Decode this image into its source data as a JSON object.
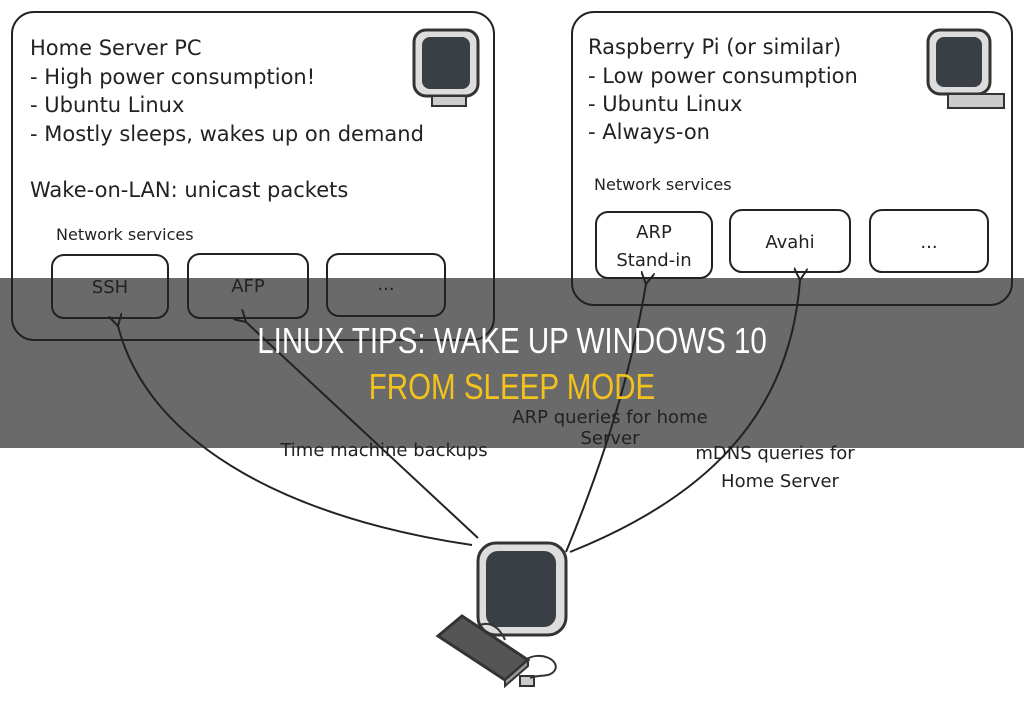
{
  "diagram": {
    "home_server": {
      "title": "Home Server PC",
      "lines": [
        "- High power consumption!",
        "- Ubuntu Linux",
        "- Mostly sleeps, wakes up on demand"
      ],
      "wol": "Wake-on-LAN: unicast packets",
      "services_label": "Network services",
      "services": [
        "SSH",
        "AFP",
        "..."
      ]
    },
    "raspberry": {
      "title": "Raspberry Pi (or similar)",
      "lines": [
        "- Low power consumption",
        "- Ubuntu Linux",
        "- Always-on"
      ],
      "services_label": "Network services",
      "services": [
        "ARP",
        "Stand-in",
        "Avahi",
        "..."
      ]
    },
    "edges": {
      "arp": [
        "ARP queries for home",
        "Server"
      ],
      "time_machine": "Time machine backups",
      "mdns": [
        "mDNS queries for",
        "Home Server"
      ]
    },
    "icons": [
      "monitor-icon",
      "computer-icon"
    ]
  },
  "overlay": {
    "title_line1": "LINUX TIPS: WAKE UP WINDOWS 10",
    "title_line2": "FROM SLEEP MODE",
    "line1_color": "#ffffff",
    "line2_color": "#f3c21b"
  }
}
